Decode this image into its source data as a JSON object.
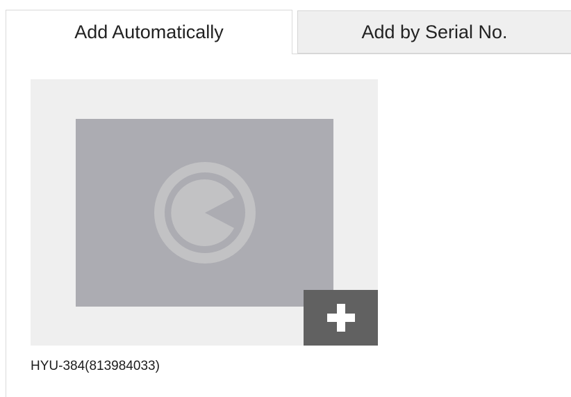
{
  "tabs": {
    "auto_label": "Add Automatically",
    "serial_label": "Add by Serial No."
  },
  "device": {
    "name": "HYU-384(813984033)",
    "thumbnail_icon": "camera-placeholder-icon",
    "add_icon": "plus-icon"
  },
  "colors": {
    "card_background": "#efefef",
    "thumbnail_background": "#acacb2",
    "add_button": "#616161",
    "inactive_tab": "#efefef"
  }
}
